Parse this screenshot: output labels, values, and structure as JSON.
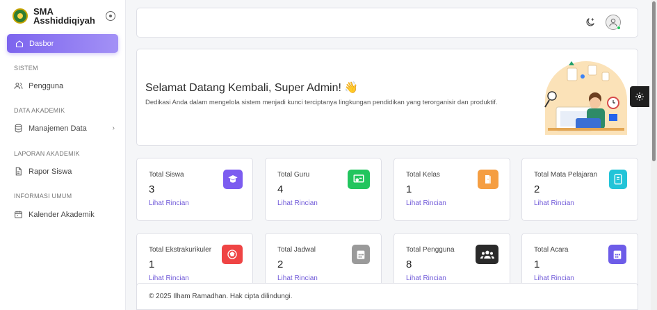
{
  "brand": {
    "name": "SMA Asshiddiqiyah",
    "logo_icon": "school-logo-icon",
    "toggle_icon": "sidebar-toggle-icon"
  },
  "sidebar": {
    "active": {
      "label": "Dasbor",
      "icon": "home-icon"
    },
    "sections": [
      {
        "title": "SISTEM",
        "items": [
          {
            "label": "Pengguna",
            "icon": "users-icon"
          }
        ]
      },
      {
        "title": "DATA AKADEMIK",
        "items": [
          {
            "label": "Manajemen Data",
            "icon": "database-icon",
            "chevron": "›"
          }
        ]
      },
      {
        "title": "LAPORAN AKADEMIK",
        "items": [
          {
            "label": "Rapor Siswa",
            "icon": "document-icon"
          }
        ]
      },
      {
        "title": "INFORMASI UMUM",
        "items": [
          {
            "label": "Kalender Akademik",
            "icon": "calendar-icon"
          }
        ]
      }
    ]
  },
  "topbar": {
    "theme_icon": "moon-icon",
    "avatar_icon": "user-avatar-icon",
    "status_color": "#22c55e"
  },
  "welcome": {
    "title": "Selamat Datang Kembali, Super Admin! 👋",
    "subtitle": "Dedikasi Anda dalam mengelola sistem menjadi kunci terciptanya lingkungan pendidikan yang terorganisir dan produktif."
  },
  "stats": [
    {
      "label": "Total Siswa",
      "value": "3",
      "link": "Lihat Rincian",
      "color": "#7c5cf0",
      "icon": "student-icon"
    },
    {
      "label": "Total Guru",
      "value": "4",
      "link": "Lihat Rincian",
      "color": "#22c55e",
      "icon": "teacher-icon"
    },
    {
      "label": "Total Kelas",
      "value": "1",
      "link": "Lihat Rincian",
      "color": "#f59e42",
      "icon": "door-icon"
    },
    {
      "label": "Total Mata Pelajaran",
      "value": "2",
      "link": "Lihat Rincian",
      "color": "#22c4d8",
      "icon": "book-icon"
    },
    {
      "label": "Total Ekstrakurikuler",
      "value": "1",
      "link": "Lihat Rincian",
      "color": "#ef4444",
      "icon": "ball-icon"
    },
    {
      "label": "Total Jadwal",
      "value": "2",
      "link": "Lihat Rincian",
      "color": "#9a9a9a",
      "icon": "schedule-icon"
    },
    {
      "label": "Total Pengguna",
      "value": "8",
      "link": "Lihat Rincian",
      "color": "#2a2a2a",
      "icon": "group-icon"
    },
    {
      "label": "Total Acara",
      "value": "1",
      "link": "Lihat Rincian",
      "color": "#6d5ce8",
      "icon": "event-calendar-icon"
    }
  ],
  "footer": {
    "text": "© 2025 Ilham Ramadhan. Hak cipta dilindungi."
  },
  "settings_icon": "gear-icon",
  "accent": "#7c64ee"
}
